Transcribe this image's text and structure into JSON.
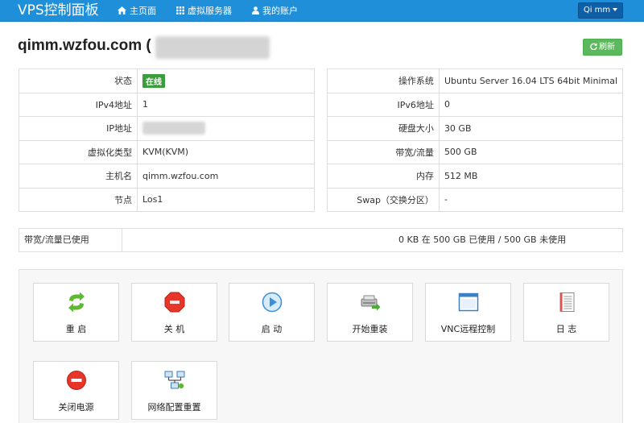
{
  "navbar": {
    "brand": "VPS控制面板",
    "items": [
      {
        "label": "主页面",
        "icon": "home-icon"
      },
      {
        "label": "虚拟服务器",
        "icon": "grid-icon"
      },
      {
        "label": "我的账户",
        "icon": "user-icon"
      }
    ],
    "user_label": "Qi mm",
    "color": "#1f8fd9"
  },
  "header": {
    "title": "qimm.wzfou.com (",
    "refresh_label": "刷新"
  },
  "info_left": [
    {
      "label": "状态",
      "value": "在线"
    },
    {
      "label": "IPv4地址",
      "value": "1"
    },
    {
      "label": "IP地址",
      "value": ""
    },
    {
      "label": "虚拟化类型",
      "value": "KVM(KVM)"
    },
    {
      "label": "主机名",
      "value": "qimm.wzfou.com"
    },
    {
      "label": "节点",
      "value": "Los1"
    }
  ],
  "info_right": [
    {
      "label": "操作系统",
      "value": "Ubuntu Server 16.04 LTS 64bit Minimal"
    },
    {
      "label": "IPv6地址",
      "value": "0"
    },
    {
      "label": "硬盘大小",
      "value": "30 GB"
    },
    {
      "label": "带宽/流量",
      "value": "500 GB"
    },
    {
      "label": "内存",
      "value": "512 MB"
    },
    {
      "label": "Swap（交换分区）",
      "value": "-"
    }
  ],
  "bandwidth": {
    "label": "带宽/流量已使用",
    "value": "0 KB 在 500 GB 已使用 / 500 GB 未使用"
  },
  "actions": [
    {
      "label": "重 启",
      "icon": "reboot-icon"
    },
    {
      "label": "关 机",
      "icon": "shutdown-icon"
    },
    {
      "label": "启 动",
      "icon": "boot-icon"
    },
    {
      "label": "开始重装",
      "icon": "reinstall-icon"
    },
    {
      "label": "VNC远程控制",
      "icon": "vnc-icon"
    },
    {
      "label": "日 志",
      "icon": "log-icon"
    },
    {
      "label": "关闭电源",
      "icon": "power-off-icon"
    },
    {
      "label": "网络配置重置",
      "icon": "network-reset-icon"
    }
  ],
  "colors": {
    "status_online": "#3c9d3c",
    "refresh_button": "#5cb85c",
    "user_button": "#0e5fa6"
  }
}
